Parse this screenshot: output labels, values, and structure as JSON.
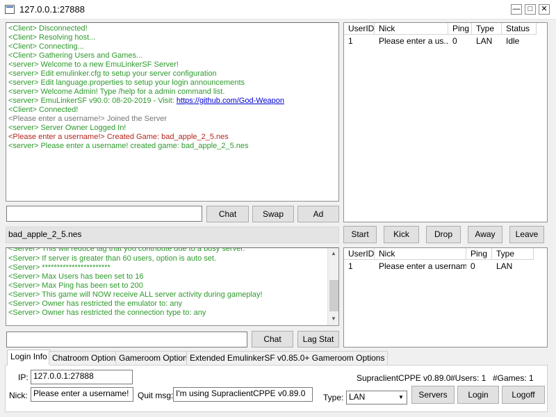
{
  "window": {
    "title": "127.0.0.1:27888",
    "min": "—",
    "max": "□",
    "close": "✕"
  },
  "server_log": [
    {
      "text": "<Client> Disconnected!",
      "color": "green"
    },
    {
      "text": "<Client> Resolving host...",
      "color": "green"
    },
    {
      "text": "<Client> Connecting...",
      "color": "green"
    },
    {
      "text": "<Client> Gathering Users and Games...",
      "color": "green"
    },
    {
      "text": "<server> Welcome to a new EmuLinkerSF Server!",
      "color": "green"
    },
    {
      "text": "<server> Edit emulinker.cfg to setup your server configuration",
      "color": "green"
    },
    {
      "text": "<server> Edit language.properties to setup your login announcements",
      "color": "green"
    },
    {
      "text": "<server> Welcome Admin! Type /help for a admin command list.",
      "color": "green"
    },
    {
      "text": "<server> EmuLinkerSF v90.0: 08-20-2019 - Visit: ",
      "color": "green"
    },
    {
      "text": "<Client> Connected!",
      "color": "green"
    },
    {
      "text": "<Please enter a username!> Joined the Server",
      "color": "gray"
    },
    {
      "text": "<server> Server Owner Logged In!",
      "color": "green"
    },
    {
      "text": "<Please enter a username!> Created Game: bad_apple_2_5.nes",
      "color": "red"
    },
    {
      "text": "<server> Please enter a username! created game: bad_apple_2_5.nes",
      "color": "green"
    }
  ],
  "server_log_link": "https://github.com/God-Weapon",
  "chat": {
    "input": "",
    "chat_label": "Chat",
    "swap_label": "Swap",
    "ad_label": "Ad"
  },
  "users_list": {
    "columns": [
      "UserID",
      "Nick",
      "Ping",
      "Type",
      "Status"
    ],
    "rows": [
      [
        "1",
        "Please enter a us...",
        "0",
        "LAN",
        "Idle"
      ]
    ]
  },
  "game": {
    "name": "bad_apple_2_5.nes",
    "start_label": "Start",
    "kick_label": "Kick",
    "drop_label": "Drop",
    "away_label": "Away",
    "leave_label": "Leave"
  },
  "game_log": [
    "<Server> This will reduce lag that you contribute due to a busy server.",
    "<Server> If server is greater than 60 users, option is auto set.",
    "<Server> ***********************",
    "<Server> Max Users has been set to 16",
    "<Server> Max Ping has been set to 200",
    "<Server> This game will NOW receive ALL server activity during gameplay!",
    "<Server> Owner has restricted the emulator to: any",
    "<Server> Owner has restricted the connection type to: any"
  ],
  "game_chat": {
    "input": "",
    "chat_label": "Chat",
    "lagstat_label": "Lag Stat"
  },
  "game_users": {
    "columns": [
      "UserID",
      "Nick",
      "Ping",
      "Type"
    ],
    "rows": [
      [
        "1",
        "Please enter a username!",
        "0",
        "LAN"
      ]
    ]
  },
  "tabs": [
    "Login Info",
    "Chatroom Options",
    "Gameroom Options",
    "Extended EmulinkerSF v0.85.0+ Gameroom Options"
  ],
  "login": {
    "ip_label": "IP:",
    "ip_value": "127.0.0.1:27888",
    "nick_label": "Nick:",
    "nick_value": "Please enter a username!",
    "quit_label": "Quit msg:",
    "quit_value": "I'm using SupraclientCPPE v0.89.0",
    "client_version": "SupraclientCPPE v0.89.0",
    "users_count": "#Users: 1",
    "games_count": "#Games: 1",
    "type_label": "Type:",
    "type_value": "LAN",
    "servers_label": "Servers",
    "login_label": "Login",
    "logoff_label": "Logoff"
  },
  "icons": {
    "scroll_up": "▲",
    "scroll_down": "▼",
    "dropdown": "▼"
  },
  "colors": {
    "green": "#2d9a2d",
    "gray": "#777777",
    "red": "#b3261e",
    "link": "#0000d0"
  }
}
